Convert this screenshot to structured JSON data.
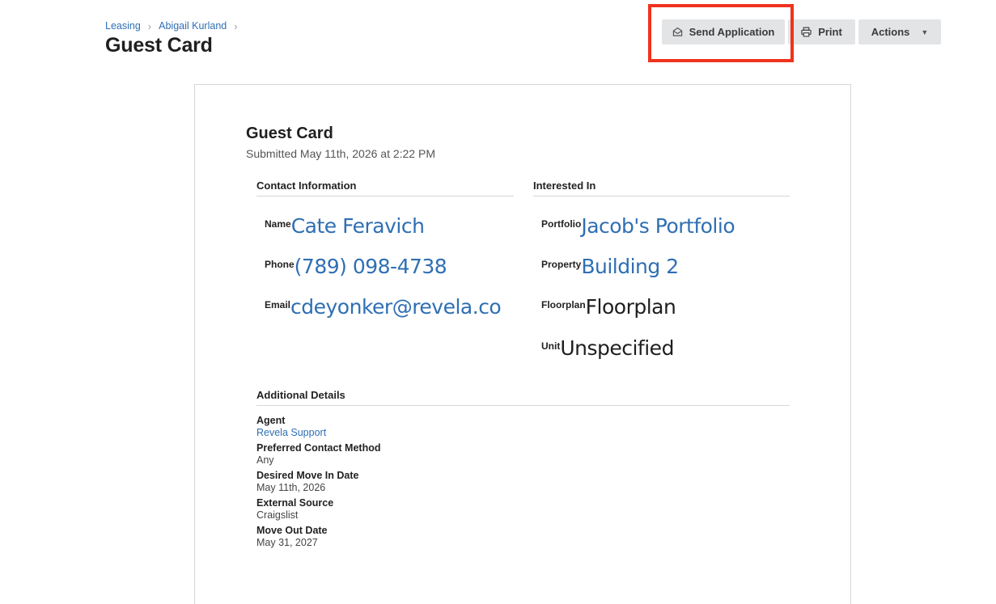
{
  "breadcrumb": {
    "items": [
      "Leasing",
      "Abigail Kurland"
    ]
  },
  "page_title": "Guest Card",
  "toolbar": {
    "send_label": "Send Application",
    "print_label": "Print",
    "actions_label": "Actions"
  },
  "card": {
    "title": "Guest Card",
    "subtitle": "Submitted May 11th, 2026 at 2:22 PM",
    "contact": {
      "heading": "Contact Information",
      "name_label": "Name",
      "name_value": "Cate Feravich",
      "phone_label": "Phone",
      "phone_value": "(789) 098-4738",
      "email_label": "Email",
      "email_value": "cdeyonker@revela.co"
    },
    "interest": {
      "heading": "Interested In",
      "portfolio_label": "Portfolio",
      "portfolio_value": "Jacob's Portfolio",
      "property_label": "Property",
      "property_value": "Building 2",
      "floorplan_label": "Floorplan",
      "floorplan_value": "Floorplan",
      "unit_label": "Unit",
      "unit_value": "Unspecified"
    },
    "additional": {
      "heading": "Additional Details",
      "agent_label": "Agent",
      "agent_value": "Revela Support",
      "contact_method_label": "Preferred Contact Method",
      "contact_method_value": "Any",
      "move_in_label": "Desired Move In Date",
      "move_in_value": "May 11th, 2026",
      "source_label": "External Source",
      "source_value": "Craigslist",
      "move_out_label": "Move Out Date",
      "move_out_value": "May 31, 2027"
    }
  },
  "colors": {
    "link": "#2f6fb3",
    "highlight": "#f0321e",
    "button_bg": "#e3e4e6"
  },
  "icons": {
    "send": "envelope-open-icon",
    "print": "printer-icon",
    "actions": "caret-down-icon",
    "breadcrumb_separator": "chevron-right-icon"
  }
}
